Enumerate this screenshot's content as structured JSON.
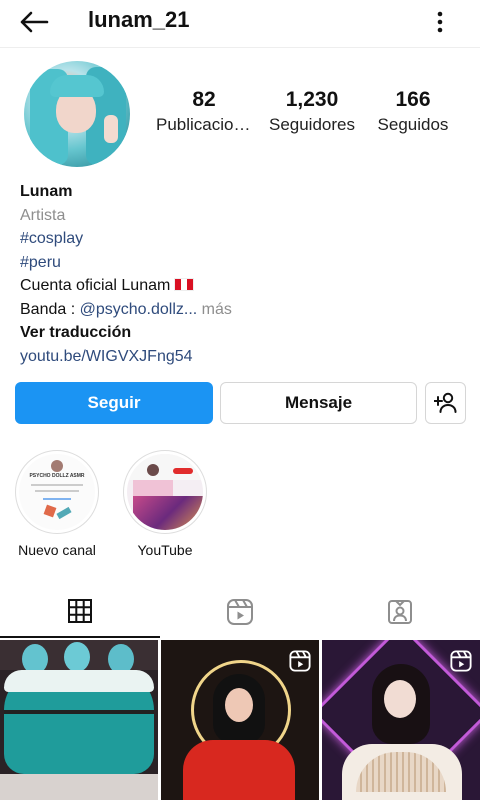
{
  "header": {
    "username": "lunam_21",
    "back_icon": "arrow-left-icon",
    "menu_icon": "more-vertical-icon"
  },
  "stats": {
    "posts_count": "82",
    "posts_label": "Publicaciones",
    "followers_count": "1,230",
    "followers_label": "Seguidores",
    "following_count": "166",
    "following_label": "Seguidos"
  },
  "bio": {
    "name": "Lunam",
    "category": "Artista",
    "hashtag1": "#cosplay",
    "hashtag2": "#peru",
    "line_official": "Cuenta oficial Lunam",
    "band_prefix": "Banda : ",
    "band_link": "@psycho.dollz...",
    "more": " más",
    "translate": "Ver traducción",
    "website": "youtu.be/WIGVXJFng54"
  },
  "actions": {
    "follow": "Seguir",
    "message": "Mensaje",
    "add_user_icon": "add-person-icon"
  },
  "highlights": [
    {
      "label": "Nuevo canal",
      "thumb_title": "PSYCHO DOLLZ ASMR"
    },
    {
      "label": "YouTube"
    }
  ],
  "tabs": [
    "grid-icon",
    "reels-icon",
    "tagged-icon"
  ],
  "colors": {
    "accent": "#1b94f3",
    "link": "#2f4b7c",
    "muted": "#8e8e8e"
  }
}
